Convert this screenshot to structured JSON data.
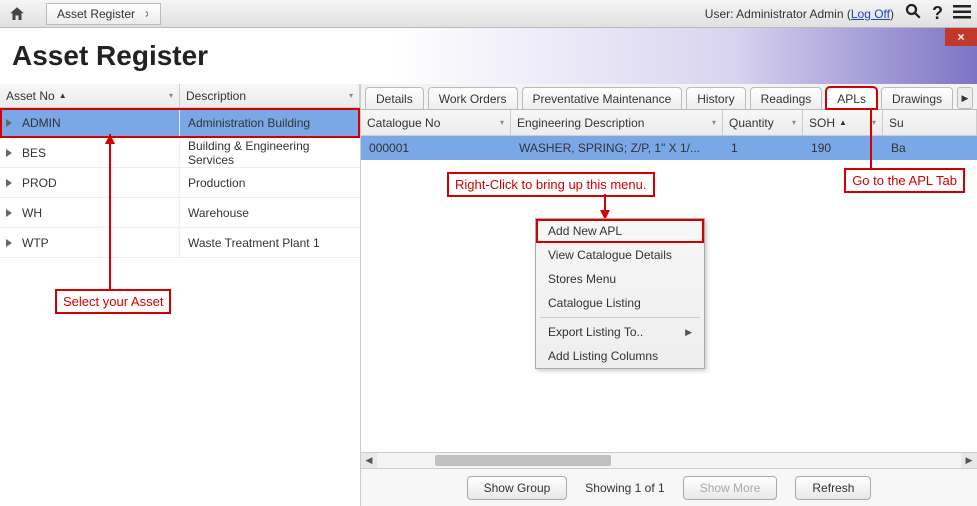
{
  "topbar": {
    "breadcrumb": "Asset Register",
    "user_prefix": "User: ",
    "user_name": "Administrator Admin",
    "logoff": "Log Off"
  },
  "title": "Asset Register",
  "tree": {
    "col_asset": "Asset No",
    "col_desc": "Description",
    "rows": [
      {
        "asset": "ADMIN",
        "desc": "Administration Building"
      },
      {
        "asset": "BES",
        "desc": "Building & Engineering Services"
      },
      {
        "asset": "PROD",
        "desc": "Production"
      },
      {
        "asset": "WH",
        "desc": "Warehouse"
      },
      {
        "asset": "WTP",
        "desc": "Waste Treatment Plant 1"
      }
    ]
  },
  "tabs": {
    "items": [
      "Details",
      "Work Orders",
      "Preventative Maintenance",
      "History",
      "Readings",
      "APLs",
      "Drawings"
    ],
    "active": "APLs"
  },
  "grid": {
    "cols": {
      "cat": "Catalogue No",
      "desc": "Engineering Description",
      "qty": "Quantity",
      "soh": "SOH",
      "rest": "Su"
    },
    "rows": [
      {
        "cat": "000001",
        "desc": "WASHER, SPRING; Z/P, 1\" X 1/...",
        "qty": "1",
        "soh": "190",
        "rest": "Ba"
      }
    ]
  },
  "context_menu": {
    "items": [
      "Add New APL",
      "View Catalogue Details",
      "Stores Menu",
      "Catalogue Listing",
      "__sep",
      "Export Listing To..",
      "Add Listing Columns"
    ]
  },
  "footer": {
    "show_group": "Show Group",
    "status": "Showing 1 of 1",
    "show_more": "Show More",
    "refresh": "Refresh"
  },
  "annotations": {
    "select_asset": "Select your Asset",
    "right_click": "Right-Click to bring up this menu.",
    "go_apl": "Go to the APL Tab"
  }
}
